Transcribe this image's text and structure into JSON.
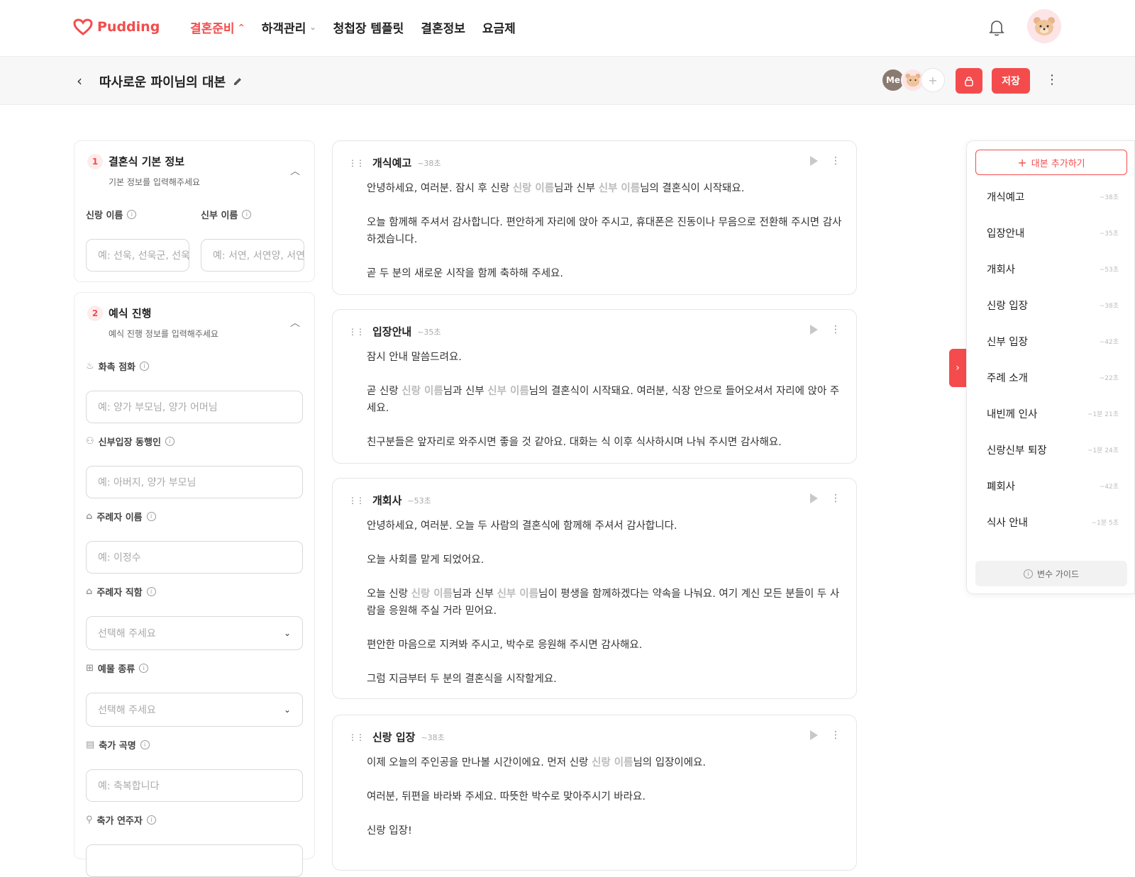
{
  "brand": {
    "name": "Pudding",
    "color": "#f44c4c"
  },
  "nav": {
    "items": [
      {
        "label": "결혼준비",
        "active": true,
        "chevron": "^"
      },
      {
        "label": "하객관리",
        "chevron": "⌄"
      },
      {
        "label": "청첩장 템플릿"
      },
      {
        "label": "결혼정보"
      },
      {
        "label": "요금제"
      }
    ]
  },
  "header": {
    "bell_icon": "bell-icon",
    "avatar_icon": "bear-avatar-icon"
  },
  "subbar": {
    "title": "따사로운 파이님의 대본",
    "collaborators": [
      "Me",
      "",
      "+"
    ],
    "save_label": "저장"
  },
  "form": {
    "section1": {
      "num": "1",
      "title": "결혼식 기본 정보",
      "sub": "기본 정보를 입력해주세요",
      "groom_label": "신랑 이름",
      "groom_placeholder": "예: 선욱, 선욱군, 선욱씨",
      "bride_label": "신부 이름",
      "bride_placeholder": "예: 서연, 서연양, 서연씨"
    },
    "section2": {
      "num": "2",
      "title": "예식 진행",
      "sub": "예식 진행 정보를 입력해주세요",
      "fields": [
        {
          "label": "화촉 점화",
          "placeholder": "예: 양가 부모님, 양가 어머님",
          "select": false
        },
        {
          "label": "신부입장 동행인",
          "placeholder": "예: 아버지, 양가 부모님",
          "select": false
        },
        {
          "label": "주례자 이름",
          "placeholder": "예: 이정수",
          "select": false
        },
        {
          "label": "주례자 직함",
          "placeholder": "선택해 주세요",
          "select": true
        },
        {
          "label": "예물 종류",
          "placeholder": "선택해 주세요",
          "select": true
        },
        {
          "label": "축가 곡명",
          "placeholder": "예: 축복합니다",
          "select": false
        },
        {
          "label": "축가 연주자",
          "placeholder": "",
          "select": false
        }
      ]
    }
  },
  "vars": {
    "groom": "신랑 이름",
    "bride": "신부 이름"
  },
  "blocks": [
    {
      "title": "개식예고",
      "dur": "~38초",
      "paras": [
        [
          "안녕하세요, 여러분. 잠시 후 신랑 ",
          "님과 신부 ",
          "님의 결혼식이 시작돼요."
        ],
        [
          "오늘 함께해 주셔서 감사합니다. 편안하게 자리에 앉아 주시고, 휴대폰은 진동이나 무음으로 전환해 주시면 감사하겠습니다."
        ],
        [
          "곧 두 분의 새로운 시작을 함께 축하해 주세요."
        ]
      ]
    },
    {
      "title": "입장안내",
      "dur": "~35초",
      "paras": [
        [
          "잠시 안내 말씀드려요."
        ],
        [
          "곧 신랑 ",
          "님과 신부 ",
          "님의 결혼식이 시작돼요. 여러분, 식장 안으로 들어오셔서 자리에 앉아 주세요."
        ],
        [
          "친구분들은 앞자리로 와주시면 좋을 것 같아요. 대화는 식 이후 식사하시며 나눠 주시면 감사해요."
        ]
      ]
    },
    {
      "title": "개회사",
      "dur": "~53초",
      "paras": [
        [
          "안녕하세요, 여러분. 오늘 두 사람의 결혼식에 함께해 주셔서 감사합니다."
        ],
        [
          "오늘 사회를 맡게 되었어요."
        ],
        [
          "오늘 신랑 ",
          "님과 신부 ",
          "님이 평생을 함께하겠다는 약속을 나눠요. 여기 계신 모든 분들이 두 사람을 응원해 주실 거라 믿어요."
        ],
        [
          "편안한 마음으로 지켜봐 주시고, 박수로 응원해 주시면 감사해요."
        ],
        [
          "그럼 지금부터 두 분의 결혼식을 시작할게요."
        ]
      ]
    },
    {
      "title": "신랑 입장",
      "dur": "~38초",
      "paras": [
        [
          "이제 오늘의 주인공을 만나볼 시간이에요. 먼저 신랑 ",
          "님의 입장이에요."
        ],
        [
          "여러분, 뒤편을 바라봐 주세요. 따뜻한 박수로 맞아주시기 바라요."
        ],
        [
          "신랑 입장!"
        ]
      ]
    }
  ],
  "toc": {
    "add_label": "대본 추가하기",
    "items": [
      {
        "label": "개식예고",
        "dur": "~38초"
      },
      {
        "label": "입장안내",
        "dur": "~35초"
      },
      {
        "label": "개회사",
        "dur": "~53초"
      },
      {
        "label": "신랑 입장",
        "dur": "~38초"
      },
      {
        "label": "신부 입장",
        "dur": "~42초"
      },
      {
        "label": "주례 소개",
        "dur": "~22초"
      },
      {
        "label": "내빈께 인사",
        "dur": "~1분 21초"
      },
      {
        "label": "신랑신부 퇴장",
        "dur": "~1분 24초"
      },
      {
        "label": "폐회사",
        "dur": "~42초"
      },
      {
        "label": "식사 안내",
        "dur": "~1분 5초"
      }
    ],
    "guide_label": "변수 가이드"
  }
}
